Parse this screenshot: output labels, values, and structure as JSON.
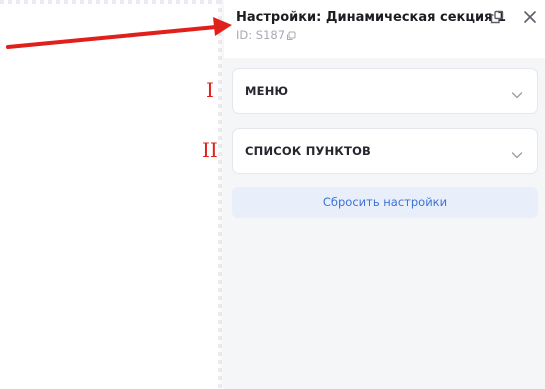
{
  "panel": {
    "title": "Настройки: Динамическая секция 1",
    "id_text": "ID: S187",
    "detach_icon": "detach-window-icon",
    "close_icon": "close-icon"
  },
  "sections": [
    {
      "label": "МЕНЮ",
      "icon": "chevron-down-icon"
    },
    {
      "label": "СПИСОК ПУНКТОВ",
      "icon": "chevron-down-icon"
    }
  ],
  "reset_label": "Сбросить настройки",
  "annotations": {
    "marker_1": "I",
    "marker_2": "II",
    "arrow_color": "#e0201b"
  },
  "colors": {
    "panel_bg": "#f5f6f8",
    "accent": "#3b73d6",
    "reset_bg": "#e8eefa"
  }
}
